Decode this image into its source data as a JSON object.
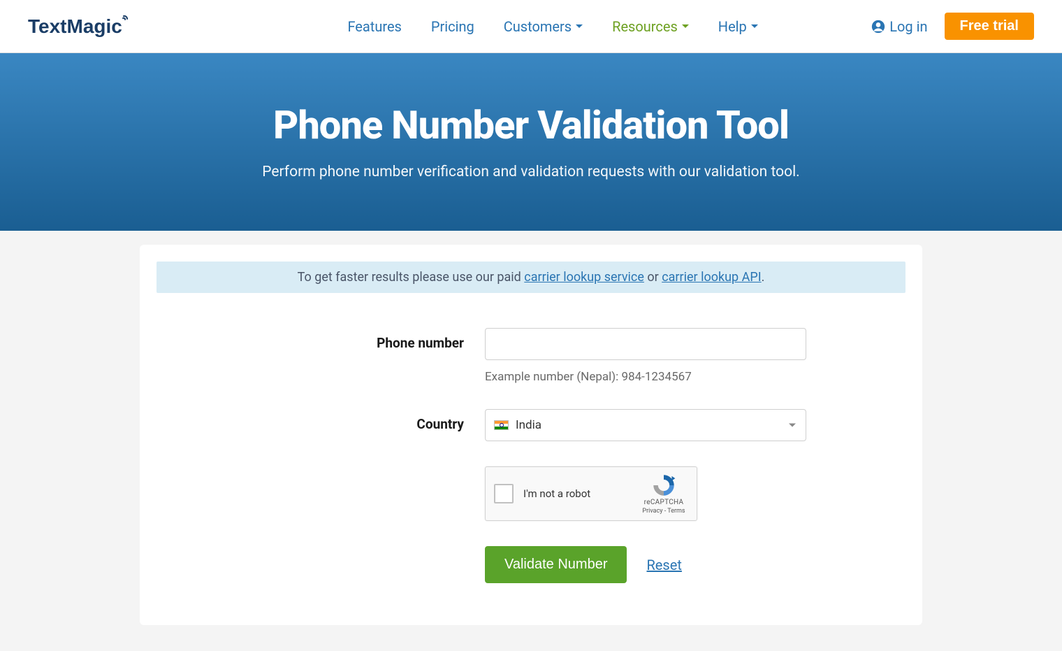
{
  "brand": "TextMagic",
  "nav": {
    "features": "Features",
    "pricing": "Pricing",
    "customers": "Customers",
    "resources": "Resources",
    "help": "Help",
    "login": "Log in",
    "free_trial": "Free trial"
  },
  "hero": {
    "title": "Phone Number Validation Tool",
    "subtitle": "Perform phone number verification and validation requests with our validation tool."
  },
  "info": {
    "prefix": "To get faster results please use our paid ",
    "link1": "carrier lookup service",
    "middle": " or ",
    "link2": "carrier lookup API",
    "suffix": "."
  },
  "form": {
    "phone_label": "Phone number",
    "phone_value": "",
    "phone_hint": "Example number (Nepal): 984-1234567",
    "country_label": "Country",
    "country_value": "India"
  },
  "captcha": {
    "label": "I'm not a robot",
    "brand": "reCAPTCHA",
    "links": "Privacy - Terms"
  },
  "buttons": {
    "validate": "Validate Number",
    "reset": "Reset"
  }
}
